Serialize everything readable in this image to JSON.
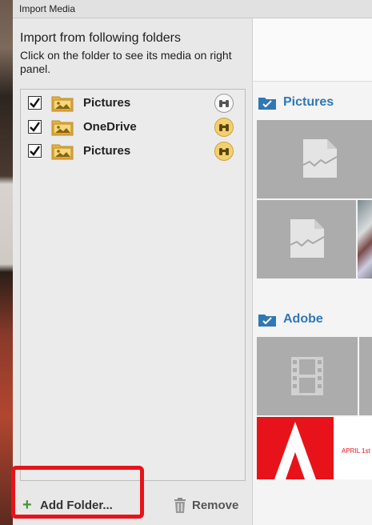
{
  "window": {
    "title": "Import Media"
  },
  "left": {
    "heading": "Import from following folders",
    "subtext": "Click on the folder to see its media on right panel."
  },
  "folders": [
    {
      "label": "Pictures",
      "checked": true,
      "watch_active": false
    },
    {
      "label": "OneDrive",
      "checked": true,
      "watch_active": true
    },
    {
      "label": "Pictures",
      "checked": true,
      "watch_active": true
    }
  ],
  "actions": {
    "add_folder": "Add Folder...",
    "remove": "Remove"
  },
  "right": {
    "sections": [
      {
        "title": "Pictures"
      },
      {
        "title": "Adobe"
      }
    ],
    "adobe_thumb_text": "APRIL 1st"
  },
  "colors": {
    "accent": "#2f78b4",
    "highlight": "#e8131a",
    "watch_active": "#f4cf6d"
  }
}
